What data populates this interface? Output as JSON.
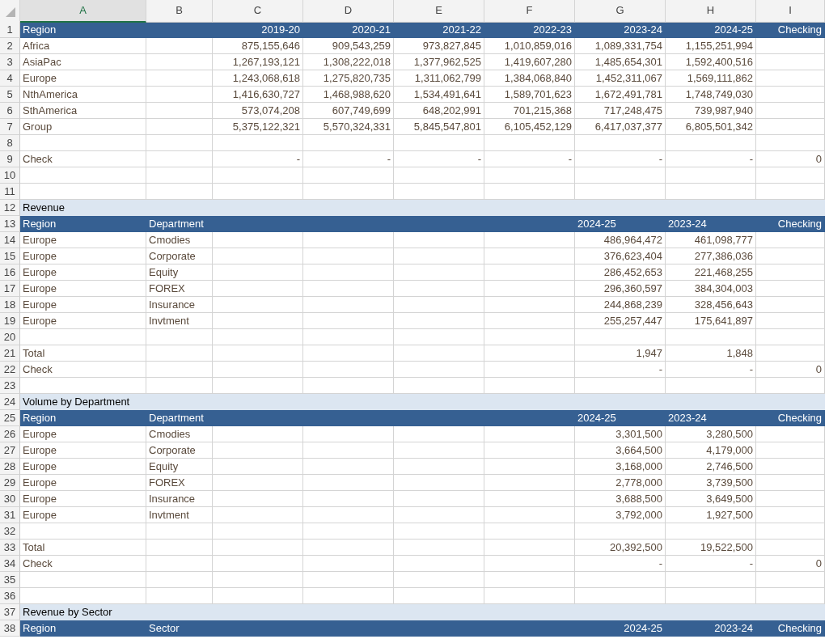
{
  "columns": [
    {
      "label": "A",
      "selected": true
    },
    {
      "label": "B",
      "selected": false
    },
    {
      "label": "C",
      "selected": false
    },
    {
      "label": "D",
      "selected": false
    },
    {
      "label": "E",
      "selected": false
    },
    {
      "label": "F",
      "selected": false
    },
    {
      "label": "G",
      "selected": false
    },
    {
      "label": "H",
      "selected": false
    },
    {
      "label": "I",
      "selected": false
    }
  ],
  "rows": [
    {
      "n": "1",
      "kind": "header",
      "left_aligned": false,
      "cells": [
        "Region",
        null,
        "2019-20",
        "2020-21",
        "2021-22",
        "2022-23",
        "2023-24",
        "2024-25",
        "Checking"
      ]
    },
    {
      "n": "2",
      "kind": "data",
      "cells": [
        "Africa",
        null,
        "875,155,646",
        "909,543,259",
        "973,827,845",
        "1,010,859,016",
        "1,089,331,754",
        "1,155,251,994",
        null
      ]
    },
    {
      "n": "3",
      "kind": "data",
      "cells": [
        "AsiaPac",
        null,
        "1,267,193,121",
        "1,308,222,018",
        "1,377,962,525",
        "1,419,607,280",
        "1,485,654,301",
        "1,592,400,516",
        null
      ]
    },
    {
      "n": "4",
      "kind": "data",
      "cells": [
        "Europe",
        null,
        "1,243,068,618",
        "1,275,820,735",
        "1,311,062,799",
        "1,384,068,840",
        "1,452,311,067",
        "1,569,111,862",
        null
      ]
    },
    {
      "n": "5",
      "kind": "data",
      "cells": [
        "NthAmerica",
        null,
        "1,416,630,727",
        "1,468,988,620",
        "1,534,491,641",
        "1,589,701,623",
        "1,672,491,781",
        "1,748,749,030",
        null
      ]
    },
    {
      "n": "6",
      "kind": "data",
      "cells": [
        "SthAmerica",
        null,
        "573,074,208",
        "607,749,699",
        "648,202,991",
        "701,215,368",
        "717,248,475",
        "739,987,940",
        null
      ]
    },
    {
      "n": "7",
      "kind": "data",
      "cells": [
        "Group",
        null,
        "5,375,122,321",
        "5,570,324,331",
        "5,845,547,801",
        "6,105,452,129",
        "6,417,037,377",
        "6,805,501,342",
        null
      ]
    },
    {
      "n": "8",
      "kind": "data"
    },
    {
      "n": "9",
      "kind": "data",
      "cells": [
        "Check",
        null,
        "-",
        "-",
        "-",
        "-",
        "-",
        "-",
        "0"
      ]
    },
    {
      "n": "10",
      "kind": "data"
    },
    {
      "n": "11",
      "kind": "data"
    },
    {
      "n": "12",
      "kind": "section",
      "cells": [
        "Revenue"
      ]
    },
    {
      "n": "13",
      "kind": "header",
      "left_aligned": true,
      "cells": [
        "Region",
        "Department",
        null,
        null,
        null,
        null,
        "2024-25",
        "2023-24",
        "Checking"
      ]
    },
    {
      "n": "14",
      "kind": "data",
      "cells": [
        "Europe",
        "Cmodies",
        null,
        null,
        null,
        null,
        "486,964,472",
        "461,098,777",
        null
      ]
    },
    {
      "n": "15",
      "kind": "data",
      "cells": [
        "Europe",
        "Corporate",
        null,
        null,
        null,
        null,
        "376,623,404",
        "277,386,036",
        null
      ]
    },
    {
      "n": "16",
      "kind": "data",
      "cells": [
        "Europe",
        "Equity",
        null,
        null,
        null,
        null,
        "286,452,653",
        "221,468,255",
        null
      ]
    },
    {
      "n": "17",
      "kind": "data",
      "cells": [
        "Europe",
        "FOREX",
        null,
        null,
        null,
        null,
        "296,360,597",
        "384,304,003",
        null
      ]
    },
    {
      "n": "18",
      "kind": "data",
      "cells": [
        "Europe",
        "Insurance",
        null,
        null,
        null,
        null,
        "244,868,239",
        "328,456,643",
        null
      ]
    },
    {
      "n": "19",
      "kind": "data",
      "cells": [
        "Europe",
        "Invtment",
        null,
        null,
        null,
        null,
        "255,257,447",
        "175,641,897",
        null
      ]
    },
    {
      "n": "20",
      "kind": "data"
    },
    {
      "n": "21",
      "kind": "data",
      "cells": [
        "Total",
        null,
        null,
        null,
        null,
        null,
        "1,947",
        "1,848",
        null
      ]
    },
    {
      "n": "22",
      "kind": "data",
      "cells": [
        "Check",
        null,
        null,
        null,
        null,
        null,
        "-",
        "-",
        "0"
      ]
    },
    {
      "n": "23",
      "kind": "data"
    },
    {
      "n": "24",
      "kind": "section",
      "cells": [
        "Volume by Department"
      ]
    },
    {
      "n": "25",
      "kind": "header",
      "left_aligned": true,
      "cells": [
        "Region",
        "Department",
        null,
        null,
        null,
        null,
        "2024-25",
        "2023-24",
        "Checking"
      ]
    },
    {
      "n": "26",
      "kind": "data",
      "cells": [
        "Europe",
        "Cmodies",
        null,
        null,
        null,
        null,
        "3,301,500",
        "3,280,500",
        null
      ]
    },
    {
      "n": "27",
      "kind": "data",
      "cells": [
        "Europe",
        "Corporate",
        null,
        null,
        null,
        null,
        "3,664,500",
        "4,179,000",
        null
      ]
    },
    {
      "n": "28",
      "kind": "data",
      "cells": [
        "Europe",
        "Equity",
        null,
        null,
        null,
        null,
        "3,168,000",
        "2,746,500",
        null
      ]
    },
    {
      "n": "29",
      "kind": "data",
      "cells": [
        "Europe",
        "FOREX",
        null,
        null,
        null,
        null,
        "2,778,000",
        "3,739,500",
        null
      ]
    },
    {
      "n": "30",
      "kind": "data",
      "cells": [
        "Europe",
        "Insurance",
        null,
        null,
        null,
        null,
        "3,688,500",
        "3,649,500",
        null
      ]
    },
    {
      "n": "31",
      "kind": "data",
      "cells": [
        "Europe",
        "Invtment",
        null,
        null,
        null,
        null,
        "3,792,000",
        "1,927,500",
        null
      ]
    },
    {
      "n": "32",
      "kind": "data"
    },
    {
      "n": "33",
      "kind": "data",
      "cells": [
        "Total",
        null,
        null,
        null,
        null,
        null,
        "20,392,500",
        "19,522,500",
        null
      ]
    },
    {
      "n": "34",
      "kind": "data",
      "cells": [
        "Check",
        null,
        null,
        null,
        null,
        null,
        "-",
        "-",
        "0"
      ]
    },
    {
      "n": "35",
      "kind": "data"
    },
    {
      "n": "36",
      "kind": "data"
    },
    {
      "n": "37",
      "kind": "section",
      "cells": [
        "Revenue by Sector"
      ]
    },
    {
      "n": "38",
      "kind": "header",
      "left_aligned": false,
      "cells": [
        "Region",
        "Sector",
        null,
        null,
        null,
        null,
        "2024-25",
        "2023-24",
        "Checking"
      ]
    }
  ]
}
